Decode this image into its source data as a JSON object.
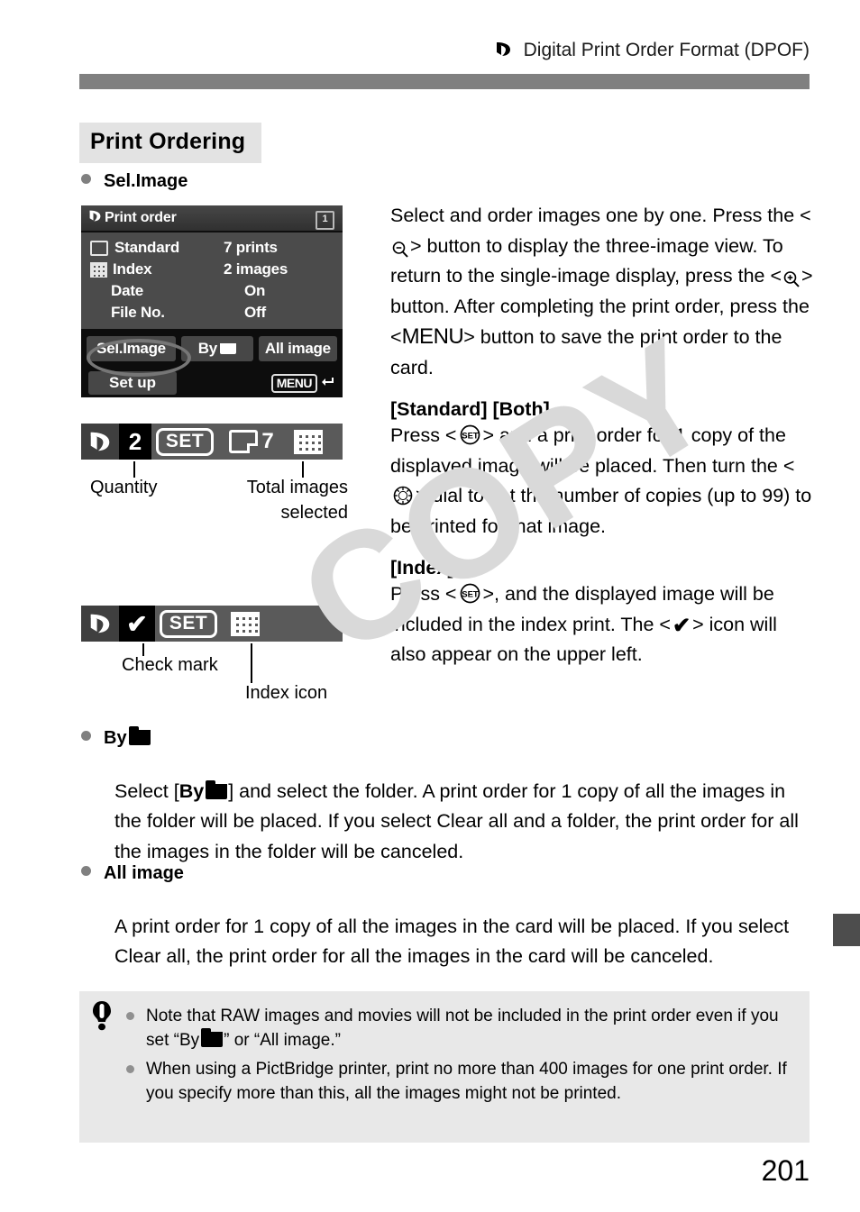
{
  "running_header": {
    "icon": "print-order-icon",
    "title": "Digital Print Order Format (DPOF)"
  },
  "section": {
    "heading": "Print Ordering"
  },
  "subsections": {
    "sel_image": "Sel.Image",
    "by_folder_prefix": "By",
    "by_folder_icon": "folder-icon",
    "all_image": "All image"
  },
  "lcd": {
    "title": "Print order",
    "title_icon": "print-order-icon",
    "folder_badge": "1",
    "rows": [
      {
        "icon": "standard-print-icon",
        "label": "Standard",
        "value": "7 prints"
      },
      {
        "icon": "index-grid-icon",
        "label": "Index",
        "value": "2 images"
      },
      {
        "icon": "",
        "label": "Date",
        "value": "On"
      },
      {
        "icon": "",
        "label": "File No.",
        "value": "Off"
      }
    ],
    "buttons": {
      "sel_image": "Sel.Image",
      "by_folder": "By",
      "all_image": "All image",
      "set_up": "Set up"
    },
    "menu_return": "MENU",
    "menu_return_arrow": "return-arrow-icon"
  },
  "strips": {
    "quantity": {
      "print_icon": "print-order-icon",
      "quantity_value": "2",
      "set_chip": "SET",
      "standard_icon": "standard-print-icon",
      "total_value": "7",
      "grid_icon": "index-grid-icon",
      "callout_quantity": "Quantity",
      "callout_total_line1": "Total images",
      "callout_total_line2": "selected"
    },
    "index": {
      "print_icon": "print-order-icon",
      "check_mark": "✔",
      "set_chip": "SET",
      "grid_icon": "index-grid-icon",
      "callout_check": "Check mark",
      "callout_index": "Index icon"
    }
  },
  "body": {
    "intro_p1_a": "Select and order images one by one. Press the <",
    "intro_p1_b": "> button to display the three-image view. To return to the single-image display, press the <",
    "intro_p1_c": "> button. After completing the print order, press the <",
    "intro_p1_menu": "MENU",
    "intro_p1_d": "> button to save the print order to the card.",
    "standard_both_head": "[Standard] [Both]",
    "standard_both_a": "Press <",
    "standard_both_b": "> and a print order for 1 copy of the displayed image will be placed. Then turn the <",
    "standard_both_c": "> dial to set the number of copies (up to 99) to be printed for that image.",
    "index_head": "[Index]",
    "index_a": "Press <",
    "index_b": ">, and the displayed image will be included in the index print. The <",
    "index_check": "✔",
    "index_c": "> icon will also appear on the upper left.",
    "by_folder_p_a": "Select [",
    "by_folder_p_bold": "By",
    "by_folder_p_b": "] and select the folder. A print order for 1 copy of all the images in the folder will be placed. If you select Clear all and a folder, the print order for all the images in the folder will be canceled.",
    "all_image_p": "A print order for 1 copy of all the images in the card will be placed. If you select Clear all, the print order for all the images in the card will be canceled."
  },
  "note_box": {
    "icon": "warning-exclamation-icon",
    "items": [
      {
        "text_a": "Note that RAW images and movies will not be included in the print order even if you set “By",
        "text_b": "” or “All image.”"
      },
      {
        "text_a": "When using a PictBridge printer, print no more than 400 images for one print order. If you specify more than this, all the images might not be printed.",
        "text_b": ""
      }
    ]
  },
  "watermark": "COPY",
  "page_number": "201",
  "colors": {
    "header_rule": "#808080",
    "heading_bg": "#e3e3e3",
    "note_bg": "#e8e8e8",
    "bullet": "#808080",
    "thumb_tab": "#4d4d4d",
    "watermark": "#d9d9d9"
  }
}
